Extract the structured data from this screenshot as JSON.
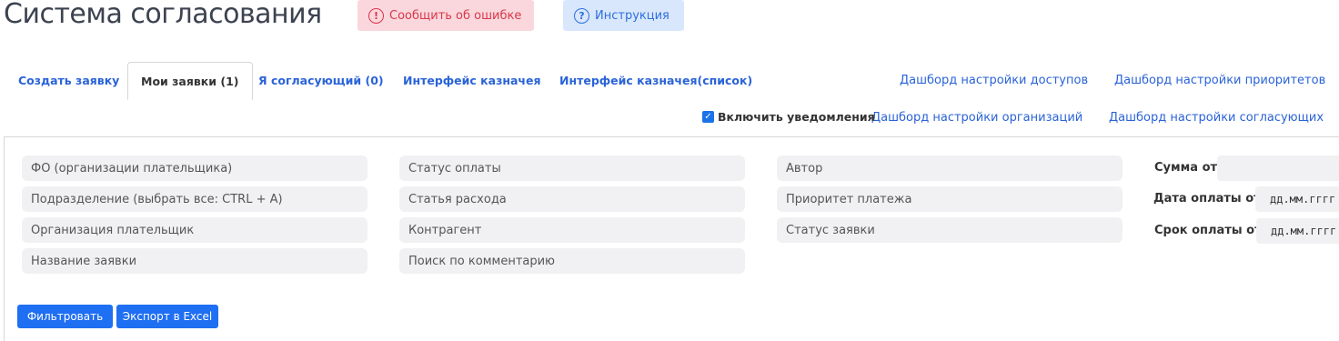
{
  "header": {
    "title": "Система согласования",
    "report_button": {
      "icon": "exclamation-circle-icon",
      "icon_glyph": "!",
      "label": "Сообщить об ошибке"
    },
    "help_button": {
      "icon": "question-circle-icon",
      "icon_glyph": "?",
      "label": "Инструкция"
    }
  },
  "tabs": [
    {
      "label": "Создать заявку",
      "active": false
    },
    {
      "label": "Мои заявки (1)",
      "active": true
    },
    {
      "label": "Я согласующий (0)",
      "active": false
    },
    {
      "label": "Интерфейс казначея",
      "active": false
    },
    {
      "label": "Интерфейс казначея(список)",
      "active": false
    }
  ],
  "dashboards": [
    "Дашборд настройки доступов",
    "Дашборд настройки приоритетов",
    "Дашборд настройки организаций",
    "Дашборд настройки согласующих"
  ],
  "notifications": {
    "label": "Включить уведомления",
    "checked": true,
    "check_glyph": "✓"
  },
  "filters": {
    "col1": [
      "ФО (организации плательщика)",
      "Подразделение (выбрать все: CTRL + A)",
      "Организация плательщик",
      "Название заявки"
    ],
    "col2": [
      "Статус оплаты",
      "Статья расхода",
      "Контрагент",
      "Поиск по комментарию"
    ],
    "col3": [
      "Автор",
      "Приоритет платежа",
      "Статус заявки"
    ],
    "sum_from": {
      "label": "Сумма от",
      "value": ""
    },
    "pay_date_from": {
      "label": "Дата оплаты от",
      "placeholder": "дд.мм.гггг"
    },
    "due_date_from": {
      "label": "Срок оплаты от",
      "placeholder": "дд.мм.гггг"
    }
  },
  "actions": {
    "filter": "Фильтровать",
    "export": "Экспорт в Excel"
  },
  "colors": {
    "accent": "#1f6ff2",
    "link": "#2a63d8",
    "danger": "#d9374b",
    "danger_bg": "#f9d7dc",
    "info_bg": "#d8e7fb",
    "field_bg": "#f1f1f3"
  }
}
